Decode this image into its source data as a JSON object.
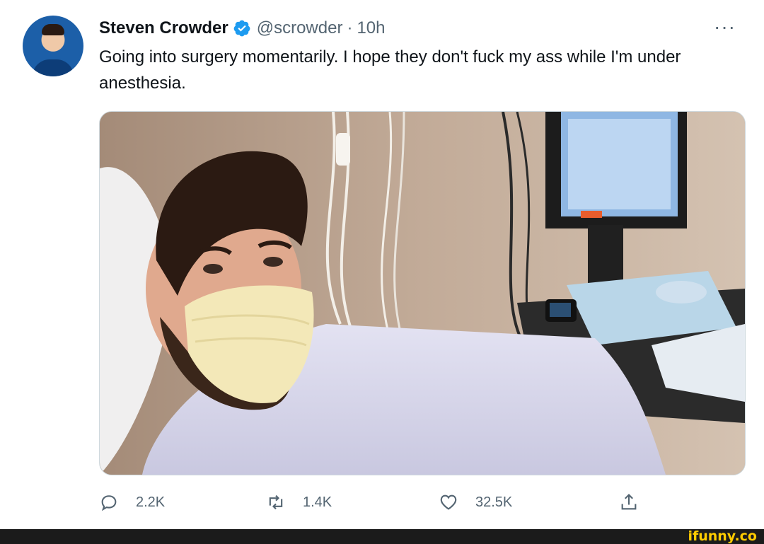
{
  "tweet": {
    "author_name": "Steven Crowder",
    "handle": "@scrowder",
    "separator": "·",
    "time": "10h",
    "more_label": "···",
    "text": "Going into surgery momentarily. I hope they don't fuck my ass while I'm under anesthesia."
  },
  "actions": {
    "reply_count": "2.2K",
    "retweet_count": "1.4K",
    "like_count": "32.5K"
  },
  "icons": {
    "verified": "verified-badge-icon",
    "reply": "reply-icon",
    "retweet": "retweet-icon",
    "like": "heart-icon",
    "share": "share-icon",
    "more": "more-icon"
  },
  "colors": {
    "verified": "#1d9bf0",
    "secondary_text": "#536471",
    "watermark": "#ffcc00"
  },
  "watermark": {
    "text": "ifunny.co"
  }
}
